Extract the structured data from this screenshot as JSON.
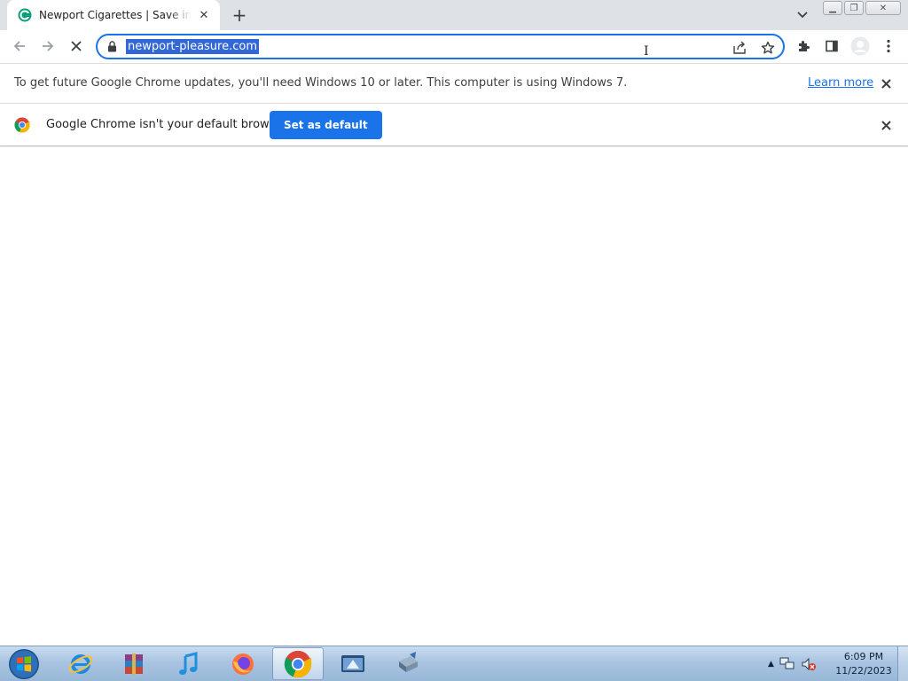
{
  "browser": {
    "tab": {
      "title": "Newport Cigarettes | Save in-store",
      "favicon": "newport-favicon",
      "close_glyph": "✕"
    },
    "new_tab_glyph": "+",
    "window_controls": {
      "minimize": "▁",
      "restore": "❐",
      "close": "✕"
    },
    "address_bar": {
      "url": "newport-pleasure.com",
      "selected": true
    }
  },
  "infobars": {
    "update_notice": {
      "text": "To get future Google Chrome updates, you'll need Windows 10 or later. This computer is using Windows 7.",
      "link": "Learn more"
    },
    "default_browser": {
      "text": "Google Chrome isn't your default browser",
      "button": "Set as default"
    }
  },
  "taskbar": {
    "apps": [
      "start-orb",
      "internet-explorer",
      "winrar",
      "itunes",
      "firefox",
      "chrome",
      "app-window",
      "network-tool"
    ],
    "active_app": "chrome",
    "clock": {
      "time": "6:09 PM",
      "date": "11/22/2023"
    }
  },
  "colors": {
    "accent": "#1a73e8",
    "tabstrip": "#dee1e6",
    "taskbar": "#a9c4e1"
  }
}
